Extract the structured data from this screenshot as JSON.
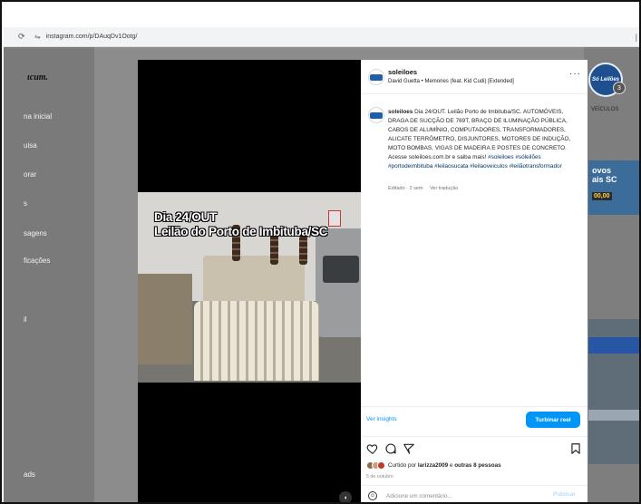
{
  "browser": {
    "url": "instagram.com/p/DAuqDv1Ootg/"
  },
  "sidebar": {
    "logo": "ɩcum.",
    "items": [
      {
        "label": "na inicial"
      },
      {
        "label": "uisa"
      },
      {
        "label": "orar"
      },
      {
        "label": "s"
      },
      {
        "label": "sagens"
      },
      {
        "label": "ficações"
      },
      {
        "label": "il"
      },
      {
        "label": "ads"
      }
    ]
  },
  "background": {
    "brand_label": "Só Leilões",
    "brand_count": "3",
    "veiculos": "VEÍCULOS",
    "ad_line1": "ovos",
    "ad_line2": "ais SC",
    "ad_price": "00,00"
  },
  "media": {
    "overlay_line1": "Dia 24/OUT",
    "overlay_line2": "Leilão do Porto de Imbituba/SC"
  },
  "post": {
    "username": "soleiloes",
    "audio": "David Guetta • Memories (feat. Kid Cudi) [Extended]",
    "caption": {
      "username": "soleiloes",
      "text": "Dia 24/OUT. Leilão Porto de Imbituba/SC. AUTOMÓVEIS, DRAGA DE SUCÇÃO DE 769T, BRAÇO DE ILUMINAÇÃO PÚBLICA, CABOS DE ALUMÍNIO, COMPUTADORES, TRANSFORMADORES, ALICATE TERRÔMETRO, DISJUNTORES, MOTORES DE INDUÇÃO, MOTO BOMBAS, VIGAS DE MADEIRA E POSTES DE CONCRETO. Acesse soleiloes.com.br e saiba mais!",
      "hashtags": "#soleiloes #sóleilões #portodeimbituba #leilaosucata #leilaoveiculos #leilãotransformador"
    },
    "edited": "Editado · 2 sem",
    "translate": "Ver tradução",
    "insights": "Ver insights",
    "boost": "Turbinar reel",
    "liked_by_prefix": "Curtido por",
    "liked_by_user": "larizza2009",
    "liked_by_suffix": "e",
    "liked_by_others": "outras 8 pessoas",
    "date": "5 de outubro",
    "comment_placeholder": "Adicione um comentário...",
    "publish": "Publicar"
  },
  "icons": {
    "heart": "heart-icon",
    "comment": "comment-icon",
    "share": "share-icon",
    "save": "bookmark-icon",
    "emoji": "emoji-icon",
    "more": "more-icon",
    "mute": "mute-icon"
  },
  "colors": {
    "accent": "#0095f6",
    "hashtag": "#00376b",
    "overlay": "#8c8c8c"
  }
}
